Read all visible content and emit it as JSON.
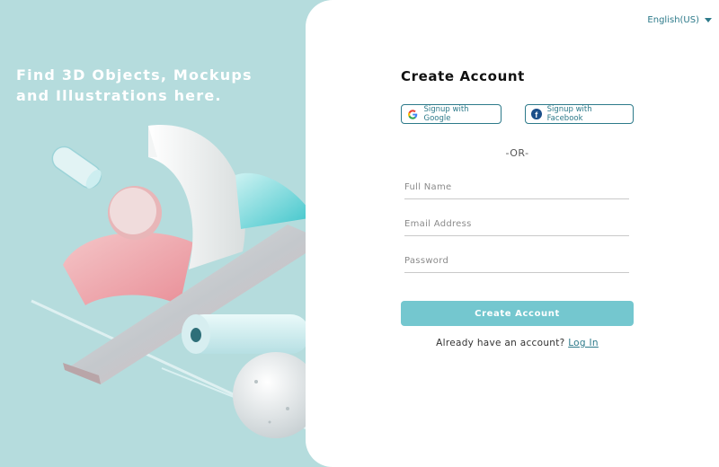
{
  "hero": {
    "line1": "Find 3D Objects, Mockups",
    "line2": "and Illustrations here."
  },
  "language": {
    "selected": "English(US)"
  },
  "form": {
    "title": "Create Account",
    "google_label": "Signup with Google",
    "facebook_label": "Signup with Facebook",
    "or_text": "-OR-",
    "fullname_placeholder": "Full Name",
    "email_placeholder": "Email Address",
    "password_placeholder": "Password",
    "submit_label": "Create Account",
    "login_prompt": "Already have an account?",
    "login_link": "Log In"
  },
  "colors": {
    "left_bg": "#b5dcdd",
    "accent": "#74c7cf",
    "link": "#2d7a8a"
  }
}
